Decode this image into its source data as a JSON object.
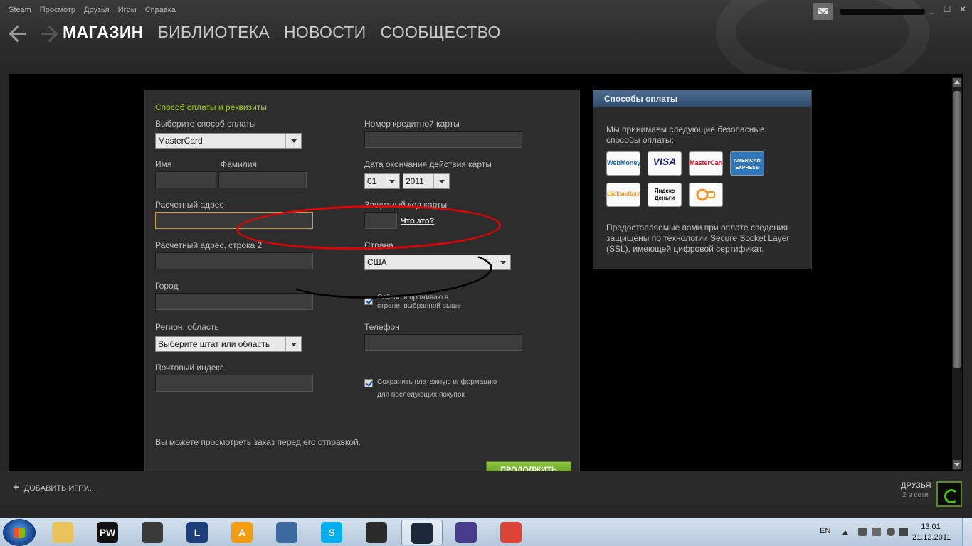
{
  "menubar": [
    "Steam",
    "Просмотр",
    "Друзья",
    "Игры",
    "Справка"
  ],
  "nav": {
    "items": [
      {
        "label": "МАГАЗИН",
        "active": true
      },
      {
        "label": "БИБЛИОТЕКА",
        "active": false
      },
      {
        "label": "НОВОСТИ",
        "active": false
      },
      {
        "label": "СООБЩЕСТВО",
        "active": false
      }
    ]
  },
  "window_buttons": [
    "_",
    "☐",
    "✕"
  ],
  "form": {
    "section_title": "Способ оплаты и реквизиты",
    "payment_method_label": "Выберите способ оплаты",
    "payment_method_value": "MasterCard",
    "first_name_label": "Имя",
    "last_name_label": "Фамилия",
    "billing_address_label": "Расчетный адрес",
    "billing_address2_label": "Расчетный адрес, строка 2",
    "city_label": "Город",
    "region_label": "Регион, область",
    "region_value": "Выберите штат или область",
    "zip_label": "Почтовый индекс",
    "card_number_label": "Номер кредитной карты",
    "expiry_label": "Дата окончания действия карты",
    "expiry_month": "01",
    "expiry_year": "2011",
    "security_code_label": "Защитный код карты",
    "whats_this": "Что это?",
    "country_label": "Страна",
    "country_value": "США",
    "resident_check": "Сейчас я проживаю в стране, выбранной выше",
    "phone_label": "Телефон",
    "save_info_check": "Сохранить платежную информацию для последующих покупок",
    "review_note": "Вы можете просмотреть заказ перед его отправкой.",
    "continue_label": "ПРОДОЛЖИТЬ"
  },
  "payment_methods": {
    "title": "Способы оплаты",
    "intro": "Мы принимаем следующие безопасные способы оплаты:",
    "logos": [
      {
        "name": "WebMoney",
        "color": "#1a5fa0"
      },
      {
        "name": "VISA",
        "color": "#1a1f71"
      },
      {
        "name": "MasterCard",
        "color": "#eb001b"
      },
      {
        "name": "AMERICAN EXPRESS",
        "color": "#2e77bb"
      },
      {
        "name": "clickandbuy",
        "color": "#f7941d"
      },
      {
        "name": "Яндекс Деньги",
        "color": "#000000"
      },
      {
        "name": "",
        "color": "#f7941d"
      }
    ],
    "ssl_note": "Предоставляемые вами при оплате сведения защищены по технологии Secure Socket Layer (SSL), имеющей цифровой сертификат."
  },
  "bottom": {
    "add_game": "ДОБАВИТЬ ИГРУ...",
    "friends_title": "ДРУЗЬЯ",
    "friends_online": "2 в сети"
  },
  "taskbar": {
    "apps": [
      {
        "name": "explorer",
        "glyph": "",
        "color": "#e8c45a",
        "active": false
      },
      {
        "name": "perfect-world",
        "glyph": "PW",
        "color": "#111111",
        "active": false
      },
      {
        "name": "skyrim",
        "glyph": "",
        "color": "#3a3a3a",
        "active": false
      },
      {
        "name": "league-of-legends",
        "glyph": "L",
        "color": "#1c3f7a",
        "active": false
      },
      {
        "name": "aimp",
        "glyph": "A",
        "color": "#f39c12",
        "active": false
      },
      {
        "name": "teamspeak",
        "glyph": "",
        "color": "#3c6aa0",
        "active": false
      },
      {
        "name": "skype",
        "glyph": "S",
        "color": "#00aff0",
        "active": false
      },
      {
        "name": "counter-strike",
        "glyph": "",
        "color": "#2a2a2a",
        "active": false
      },
      {
        "name": "steam",
        "glyph": "",
        "color": "#1b2838",
        "active": true
      },
      {
        "name": "bittorrent",
        "glyph": "",
        "color": "#4a3c8c",
        "active": false
      },
      {
        "name": "chrome",
        "glyph": "",
        "color": "#db4437",
        "active": false
      }
    ],
    "lang": "EN",
    "time": "13:01",
    "date": "21.12.2011"
  }
}
